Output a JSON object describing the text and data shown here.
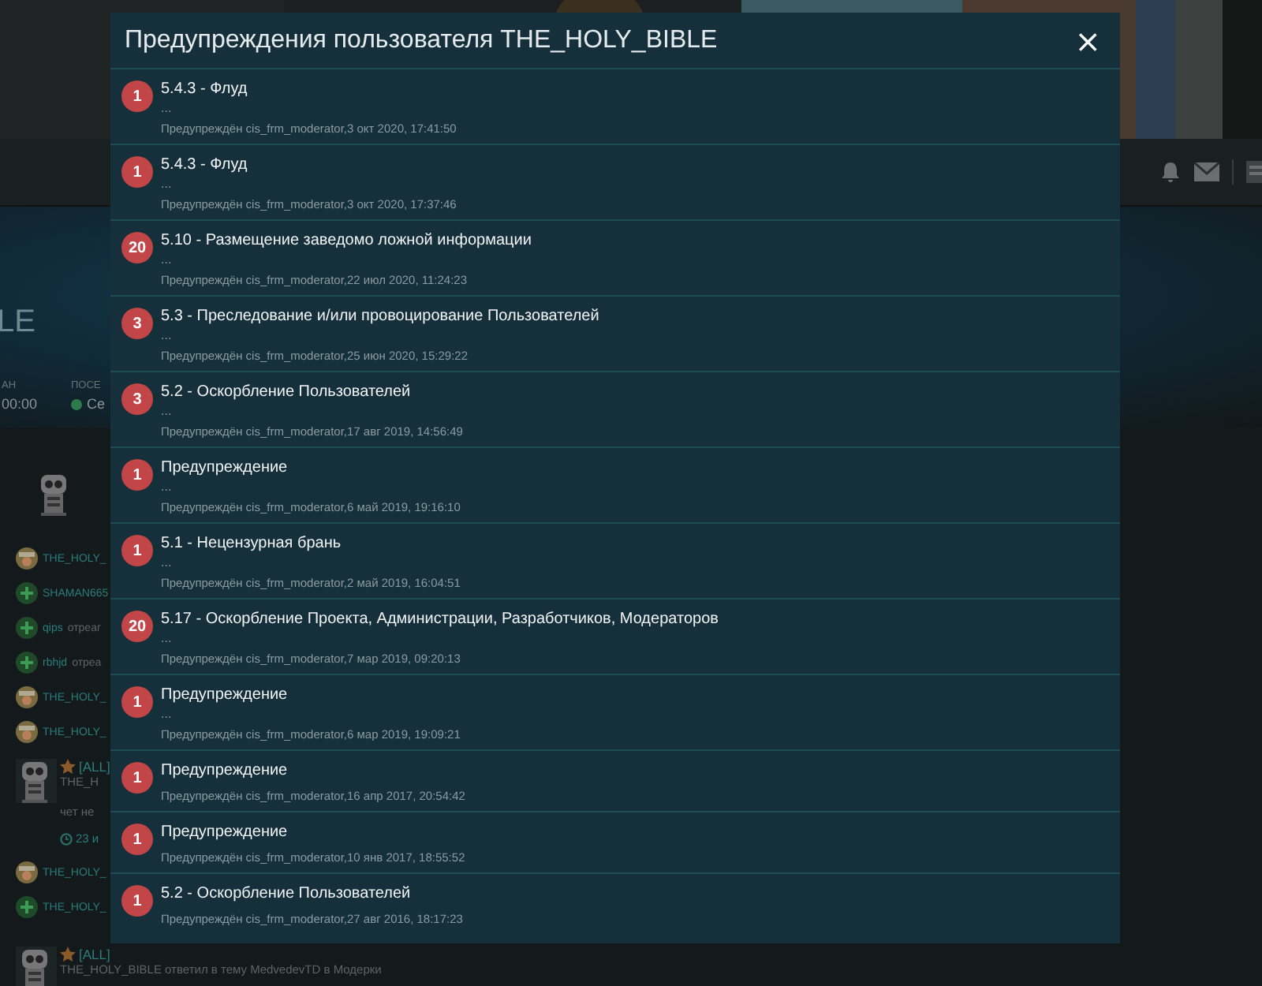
{
  "background": {
    "banner_name": "LE",
    "stats": [
      {
        "label": "АН",
        "value": "00:00",
        "online": false
      },
      {
        "label": "ПОСЕ",
        "value": "Се",
        "online": true
      }
    ],
    "activity": [
      {
        "kind": "user",
        "name": "THE_HOLY_"
      },
      {
        "kind": "reaction",
        "name": "SHAMAN665"
      },
      {
        "kind": "reaction",
        "name": "qips",
        "text": "отреаг"
      },
      {
        "kind": "reaction",
        "name": "rbhjd",
        "text": "отреа"
      },
      {
        "kind": "user",
        "name": "THE_HOLY_"
      },
      {
        "kind": "user",
        "name": "THE_HOLY_"
      },
      {
        "kind": "post",
        "title": "[ALL]",
        "sub": "THE_H",
        "excerpt": "чет не",
        "time": "23 и"
      },
      {
        "kind": "user",
        "name": "THE_HOLY_"
      },
      {
        "kind": "reaction",
        "name": "THE_HOLY_"
      },
      {
        "kind": "post",
        "title": "[ALL]",
        "sub": "THE_HOLY_BIBLE ответил в тему MedvedevTD в Модерки"
      }
    ]
  },
  "modal": {
    "title": "Предупреждения пользователя THE_HOLY_BIBLE",
    "close": "×",
    "warnings": [
      {
        "points": "1",
        "title": "5.4.3 - Флуд",
        "comment": "...",
        "meta": "Предупреждён cis_frm_moderator,3 окт 2020, 17:41:50"
      },
      {
        "points": "1",
        "title": "5.4.3 - Флуд",
        "comment": "...",
        "meta": "Предупреждён cis_frm_moderator,3 окт 2020, 17:37:46"
      },
      {
        "points": "20",
        "title": "5.10 - Размещение заведомо ложной информации",
        "comment": "...",
        "meta": "Предупреждён cis_frm_moderator,22 июл 2020, 11:24:23"
      },
      {
        "points": "3",
        "title": "5.3 - Преследование и/или провоцирование Пользователей",
        "comment": "...",
        "meta": "Предупреждён cis_frm_moderator,25 июн 2020, 15:29:22"
      },
      {
        "points": "3",
        "title": "5.2 - Оскорбление Пользователей",
        "comment": "...",
        "meta": "Предупреждён cis_frm_moderator,17 авг 2019, 14:56:49"
      },
      {
        "points": "1",
        "title": "Предупреждение",
        "comment": "...",
        "meta": "Предупреждён cis_frm_moderator,6 май 2019, 19:16:10"
      },
      {
        "points": "1",
        "title": "5.1 - Нецензурная брань",
        "comment": "...",
        "meta": "Предупреждён cis_frm_moderator,2 май 2019, 16:04:51"
      },
      {
        "points": "20",
        "title": "5.17 - Оскорбление Проекта, Администрации, Разработчиков, Модераторов",
        "comment": "...",
        "meta": "Предупреждён cis_frm_moderator,7 мар 2019, 09:20:13"
      },
      {
        "points": "1",
        "title": "Предупреждение",
        "comment": "...",
        "meta": "Предупреждён cis_frm_moderator,6 мар 2019, 19:09:21"
      },
      {
        "points": "1",
        "title": "Предупреждение",
        "meta": "Предупреждён cis_frm_moderator,16 апр 2017, 20:54:42"
      },
      {
        "points": "1",
        "title": "Предупреждение",
        "meta": "Предупреждён cis_frm_moderator,10 янв 2017, 18:55:52"
      },
      {
        "points": "1",
        "title": "5.2 - Оскорбление Пользователей",
        "meta": "Предупреждён cis_frm_moderator,27 авг 2016, 18:17:23"
      }
    ]
  }
}
